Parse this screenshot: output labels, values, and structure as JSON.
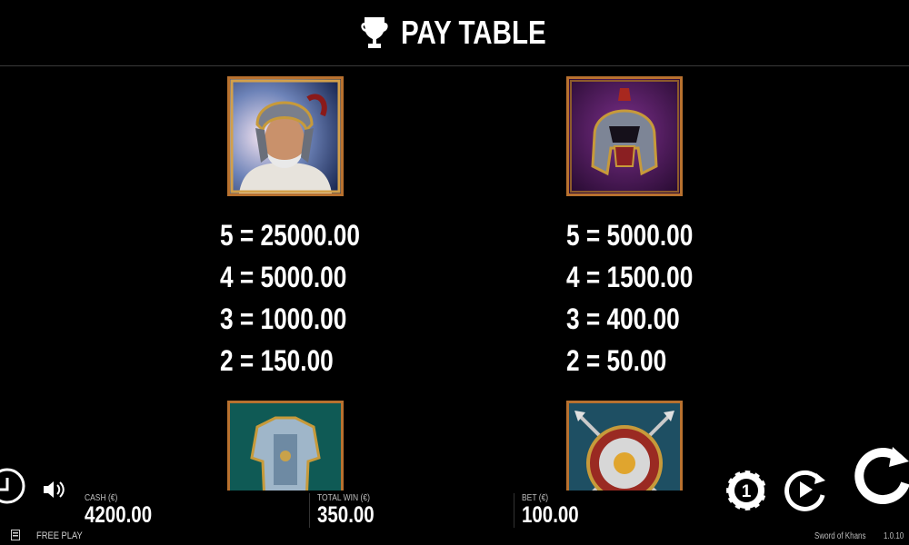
{
  "header": {
    "title": "PAY TABLE",
    "icon": "trophy-icon"
  },
  "symbols": [
    {
      "name": "khan-warrior",
      "payouts": [
        "5 = 25000.00",
        "4 = 5000.00",
        "3 = 1000.00",
        "2 = 150.00"
      ]
    },
    {
      "name": "helmet",
      "payouts": [
        "5 = 5000.00",
        "4 = 1500.00",
        "3 = 400.00",
        "2 = 50.00"
      ]
    },
    {
      "name": "armor",
      "payouts": []
    },
    {
      "name": "shield",
      "payouts": []
    }
  ],
  "meters": {
    "cash_label": "CASH (€)",
    "cash_value": "4200.00",
    "total_win_label": "TOTAL WIN (€)",
    "total_win_value": "350.00",
    "bet_label": "BET (€)",
    "bet_value": "100.00"
  },
  "footer": {
    "mode": "FREE PLAY",
    "game_name": "Sword of Khans",
    "version": "1.0.10"
  },
  "controls": {
    "bet_chip_value": "1",
    "icons": [
      "home-icon",
      "sound-icon",
      "bet-chip-icon",
      "autoplay-icon",
      "spin-icon"
    ]
  },
  "colors": {
    "background": "#000000",
    "frame": "#b8712f",
    "text": "#ffffff"
  }
}
